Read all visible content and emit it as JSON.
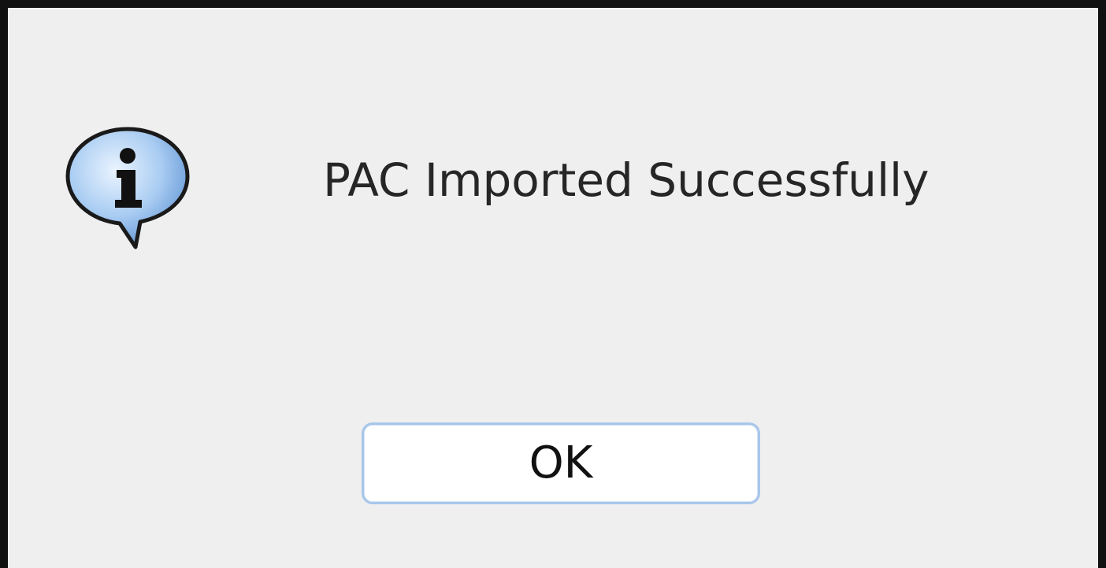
{
  "dialog": {
    "icon": "info-icon",
    "message": "PAC Imported Successfully",
    "ok_label": "OK"
  },
  "colors": {
    "background": "#efefef",
    "border": "#111111",
    "button_border": "#a7c6ea",
    "icon_blue": "#7fb0e6"
  }
}
